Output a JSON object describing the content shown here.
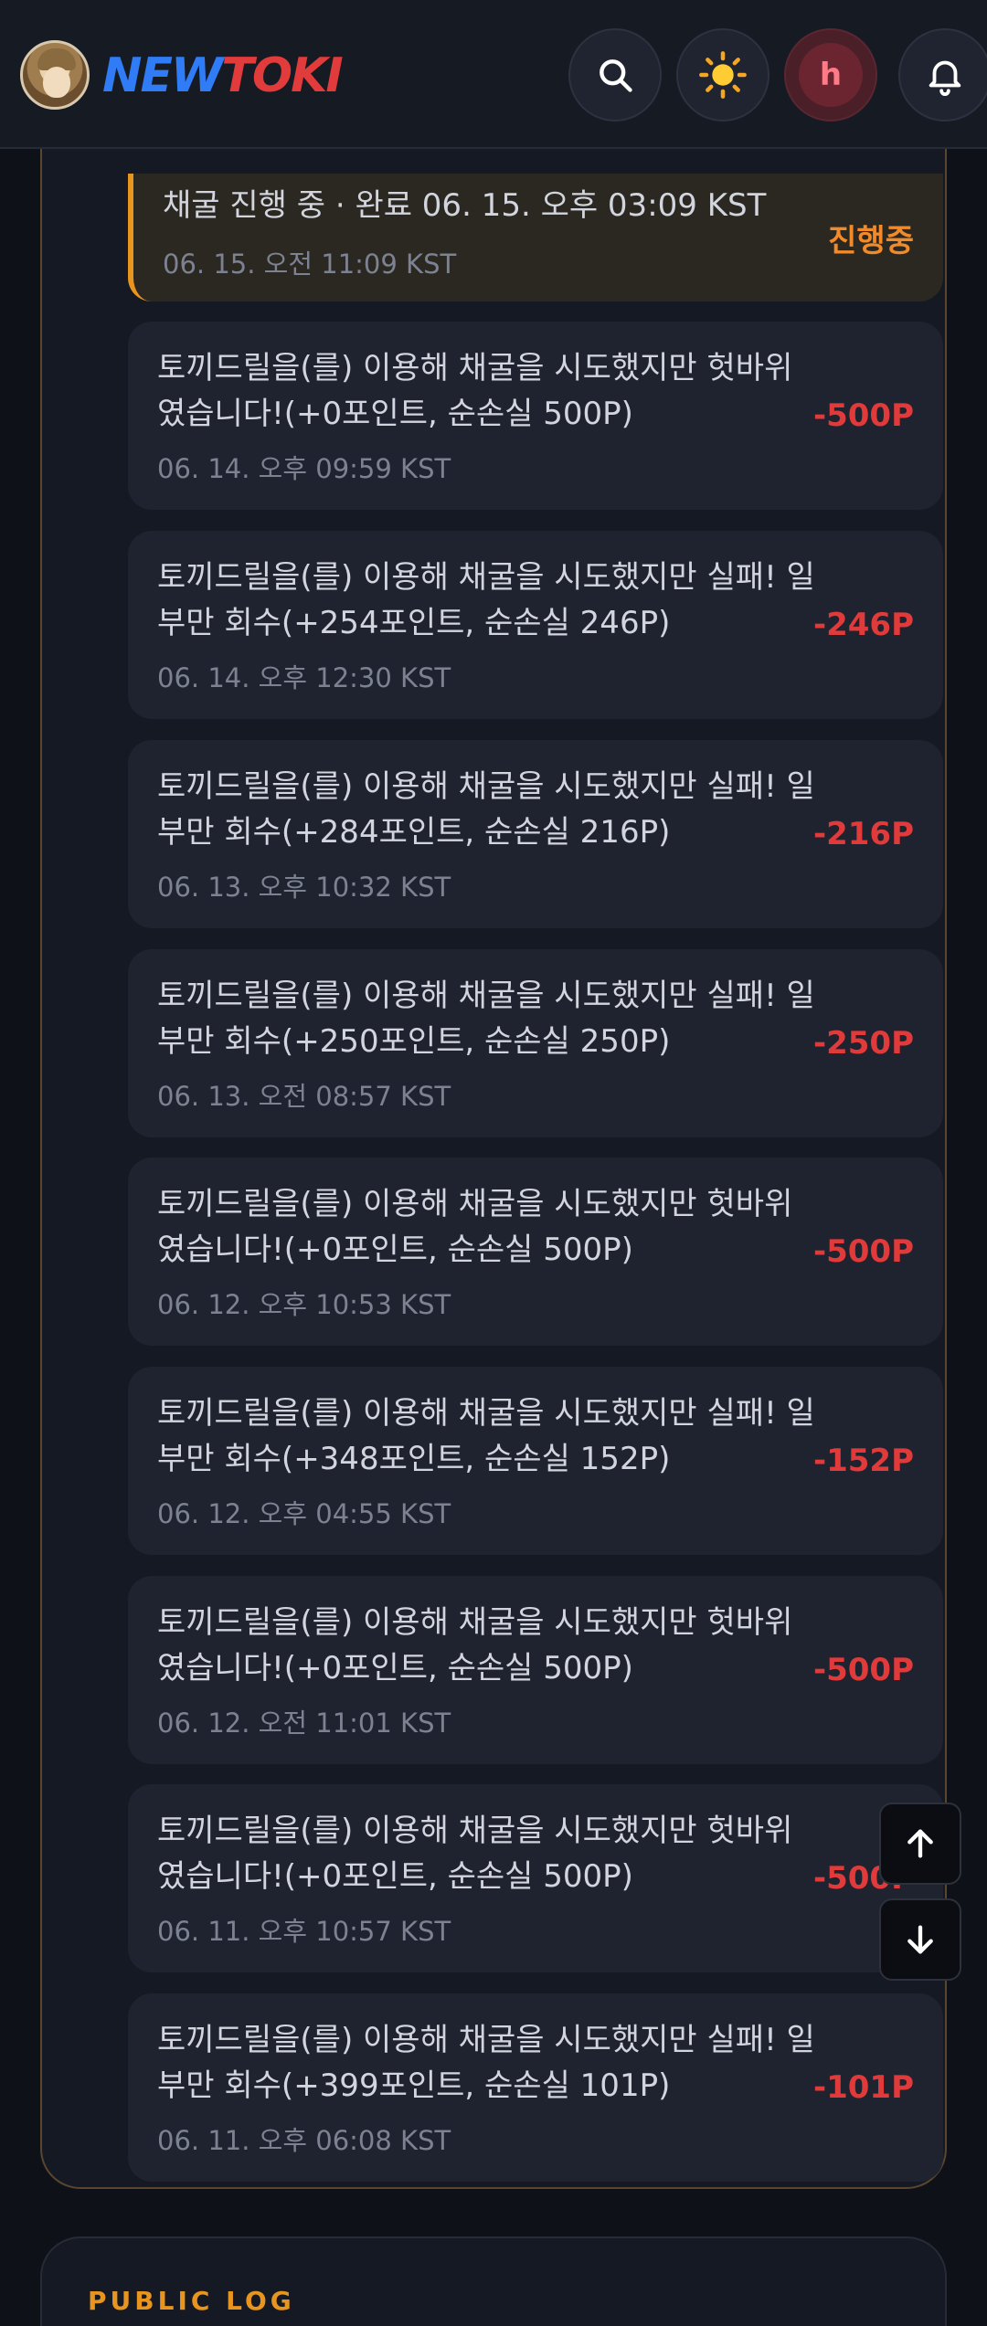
{
  "brand": {
    "new": "NEW",
    "toki": "TOKI"
  },
  "header_icons": [
    "search-icon",
    "sun-icon",
    "user-avatar",
    "bell-icon"
  ],
  "user": {
    "initial": "h"
  },
  "logs": [
    {
      "message": "채굴 진행 중 · 완료 06. 15. 오후 03:09 KST",
      "time": "06. 15. 오전 11:09 KST",
      "amount": "진행중",
      "status": "progress"
    },
    {
      "message": "토끼드릴을(를) 이용해 채굴을 시도했지만 헛바위였습니다!(+0포인트, 순손실 500P)",
      "time": "06. 14. 오후 09:59 KST",
      "amount": "-500P",
      "status": "loss"
    },
    {
      "message": "토끼드릴을(를) 이용해 채굴을 시도했지만 실패! 일부만 회수(+254포인트, 순손실 246P)",
      "time": "06. 14. 오후 12:30 KST",
      "amount": "-246P",
      "status": "loss"
    },
    {
      "message": "토끼드릴을(를) 이용해 채굴을 시도했지만 실패! 일부만 회수(+284포인트, 순손실 216P)",
      "time": "06. 13. 오후 10:32 KST",
      "amount": "-216P",
      "status": "loss"
    },
    {
      "message": "토끼드릴을(를) 이용해 채굴을 시도했지만 실패! 일부만 회수(+250포인트, 순손실 250P)",
      "time": "06. 13. 오전 08:57 KST",
      "amount": "-250P",
      "status": "loss"
    },
    {
      "message": "토끼드릴을(를) 이용해 채굴을 시도했지만 헛바위였습니다!(+0포인트, 순손실 500P)",
      "time": "06. 12. 오후 10:53 KST",
      "amount": "-500P",
      "status": "loss"
    },
    {
      "message": "토끼드릴을(를) 이용해 채굴을 시도했지만 실패! 일부만 회수(+348포인트, 순손실 152P)",
      "time": "06. 12. 오후 04:55 KST",
      "amount": "-152P",
      "status": "loss"
    },
    {
      "message": "토끼드릴을(를) 이용해 채굴을 시도했지만 헛바위였습니다!(+0포인트, 순손실 500P)",
      "time": "06. 12. 오전 11:01 KST",
      "amount": "-500P",
      "status": "loss"
    },
    {
      "message": "토끼드릴을(를) 이용해 채굴을 시도했지만 헛바위였습니다!(+0포인트, 순손실 500P)",
      "time": "06. 11. 오후 10:57 KST",
      "amount": "-500P",
      "status": "loss"
    },
    {
      "message": "토끼드릴을(를) 이용해 채굴을 시도했지만 실패! 일부만 회수(+399포인트, 순손실 101P)",
      "time": "06. 11. 오후 06:08 KST",
      "amount": "-101P",
      "status": "loss"
    }
  ],
  "public_log": {
    "title": "PUBLIC LOG"
  },
  "colors": {
    "accent": "#e8951f",
    "loss": "#e03a3a",
    "brand_blue": "#2f7cf6",
    "brand_red": "#e23b3b"
  }
}
